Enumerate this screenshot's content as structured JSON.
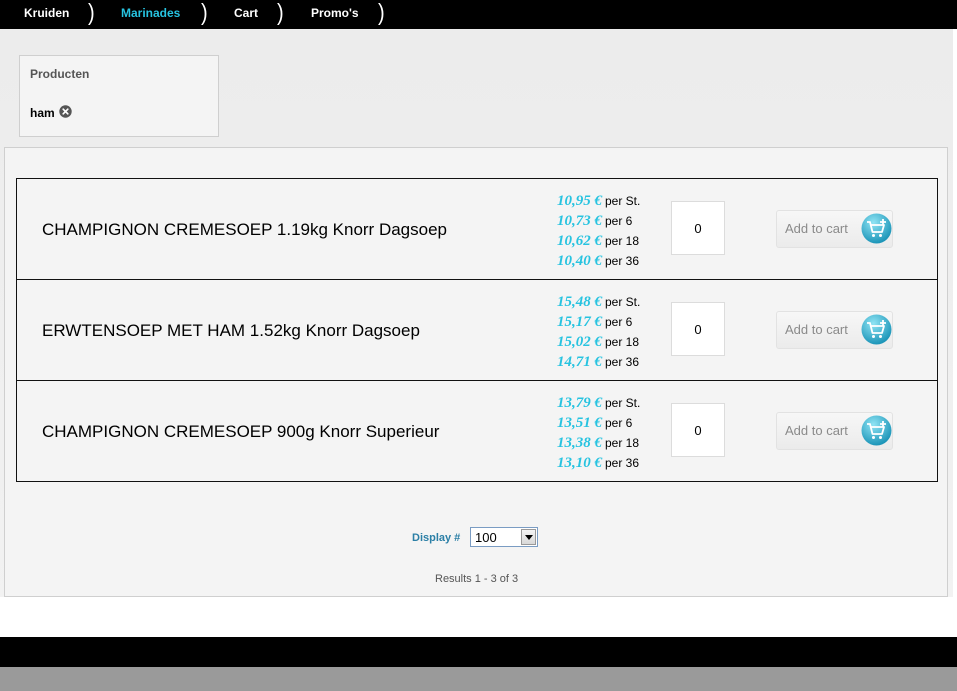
{
  "nav": {
    "items": [
      {
        "label": "Kruiden",
        "active": false
      },
      {
        "label": "Marinades",
        "active": true
      },
      {
        "label": "Cart",
        "active": false
      },
      {
        "label": "Promo's",
        "active": false
      }
    ],
    "separator": ")"
  },
  "filter": {
    "title": "Producten",
    "chip": "ham",
    "remove_icon": "close-circle-icon"
  },
  "products": [
    {
      "name": "CHAMPIGNON CREMESOEP 1.19kg Knorr Dagsoep",
      "prices": [
        {
          "price": "10,95 €",
          "unit": "per St."
        },
        {
          "price": "10,73 €",
          "unit": "per 6"
        },
        {
          "price": "10,62 €",
          "unit": "per 18"
        },
        {
          "price": "10,40 €",
          "unit": "per 36"
        }
      ],
      "quantity": "0",
      "add_label": "Add to cart"
    },
    {
      "name": "ERWTENSOEP MET HAM 1.52kg Knorr Dagsoep",
      "prices": [
        {
          "price": "15,48 €",
          "unit": "per St."
        },
        {
          "price": "15,17 €",
          "unit": "per 6"
        },
        {
          "price": "15,02 €",
          "unit": "per 18"
        },
        {
          "price": "14,71 €",
          "unit": "per 36"
        }
      ],
      "quantity": "0",
      "add_label": "Add to cart"
    },
    {
      "name": "CHAMPIGNON CREMESOEP 900g Knorr Superieur",
      "prices": [
        {
          "price": "13,79 €",
          "unit": "per St."
        },
        {
          "price": "13,51 €",
          "unit": "per 6"
        },
        {
          "price": "13,38 €",
          "unit": "per 18"
        },
        {
          "price": "13,10 €",
          "unit": "per 36"
        }
      ],
      "quantity": "0",
      "add_label": "Add to cart"
    }
  ],
  "pagination": {
    "display_label": "Display #",
    "display_value": "100",
    "results": "Results 1 - 3 of 3"
  },
  "colors": {
    "accent": "#27c3e0",
    "nav_bg": "#000000",
    "display_label": "#2b7fa6"
  }
}
